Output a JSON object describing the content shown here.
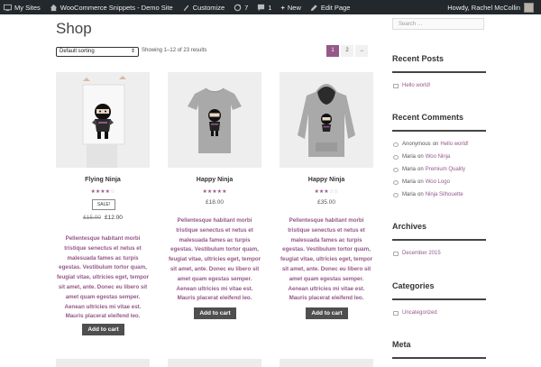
{
  "admin_bar": {
    "my_sites": "My Sites",
    "site_name": "WooCommerce Snippets - Demo Site",
    "customize": "Customize",
    "updates_count": "7",
    "comments_count": "1",
    "new_label": "New",
    "edit_page": "Edit Page",
    "howdy": "Howdy, Rachel McCollin"
  },
  "main": {
    "title": "Shop",
    "sort_value": "Default sorting",
    "result_count": "Showing 1–12 of 23 results",
    "pagination": [
      "1",
      "2",
      "→"
    ],
    "current_page": "1"
  },
  "products": [
    {
      "title": "Flying Ninja",
      "rating": 4,
      "sale_badge": "SALE!",
      "regular_price": "£15.00",
      "sale_price": "£12.00",
      "description": "Pellentesque habitant morbi tristique senectus et netus et malesuada fames ac turpis egestas. Vestibulum tortor quam, feugiat vitae, ultricies eget, tempor sit amet, ante. Donec eu libero sit amet quam egestas semper. Aenean ultricies mi vitae est. Mauris placerat eleifend leo.",
      "button": "Add to cart",
      "image": "ninja-poster"
    },
    {
      "title": "Happy Ninja",
      "rating": 5,
      "price": "£18.00",
      "description": "Pellentesque habitant morbi tristique senectus et netus et malesuada fames ac turpis egestas. Vestibulum tortor quam, feugiat vitae, ultricies eget, tempor sit amet, ante. Donec eu libero sit amet quam egestas semper. Aenean ultricies mi vitae est. Mauris placerat eleifend leo.",
      "button": "Add to cart",
      "image": "ninja-tshirt"
    },
    {
      "title": "Happy Ninja",
      "rating": 3,
      "price": "£35.00",
      "description": "Pellentesque habitant morbi tristique senectus et netus et malesuada fames ac turpis egestas. Vestibulum tortor quam, feugiat vitae, ultricies eget, tempor sit amet, ante. Donec eu libero sit amet quam egestas semper. Aenean ultricies mi vitae est. Mauris placerat eleifend leo.",
      "button": "Add to cart",
      "image": "ninja-hoodie"
    }
  ],
  "sidebar": {
    "search_placeholder": "Search …",
    "recent_posts": {
      "title": "Recent Posts",
      "items": [
        "Hello world!"
      ]
    },
    "recent_comments": {
      "title": "Recent Comments",
      "on_word": "on",
      "items": [
        {
          "author": "Anonymous",
          "post": "Hello world!"
        },
        {
          "author": "Maria",
          "post": "Woo Ninja"
        },
        {
          "author": "Maria",
          "post": "Premium Quality"
        },
        {
          "author": "Maria",
          "post": "Woo Logo"
        },
        {
          "author": "Maria",
          "post": "Ninja Silhouette"
        }
      ]
    },
    "archives": {
      "title": "Archives",
      "items": [
        "December 2015"
      ]
    },
    "categories": {
      "title": "Categories",
      "items": [
        "Uncategorized"
      ]
    },
    "meta": {
      "title": "Meta"
    }
  },
  "colors": {
    "admin_bar": "#23282d",
    "accent": "#96588a",
    "button": "#4f4f4f"
  }
}
